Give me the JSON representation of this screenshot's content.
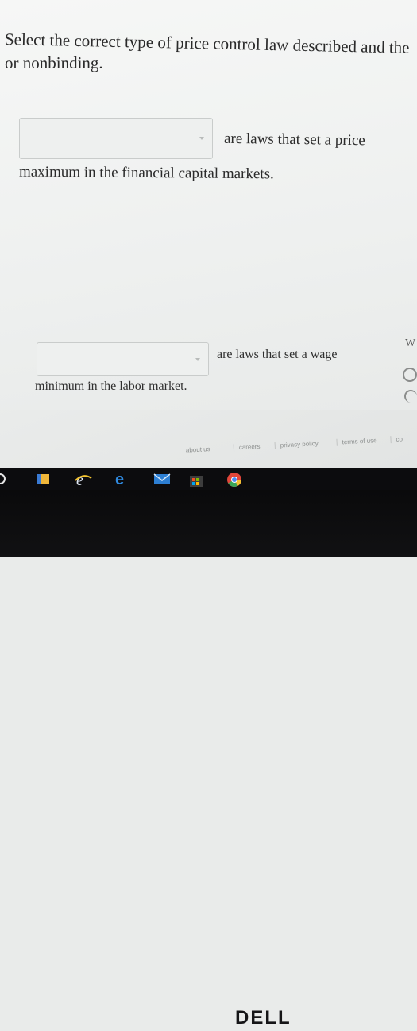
{
  "question": {
    "prompt_line1": "Select the correct type of price control law described and the",
    "prompt_line2": "or nonbinding."
  },
  "items": [
    {
      "select_value": "",
      "text_after": "are laws that set a price",
      "text_continued": "maximum in the financial capital markets."
    },
    {
      "select_value": "",
      "text_after": "are laws that set a wage",
      "text_continued": "minimum in the labor market."
    }
  ],
  "right_edge": {
    "letter": "W"
  },
  "footer": {
    "links": [
      "about us",
      "careers",
      "privacy policy",
      "terms of use",
      "co"
    ]
  },
  "taskbar": {
    "icons": [
      "back-circle-icon",
      "file-manager-icon",
      "internet-explorer-icon",
      "edge-icon",
      "mail-icon",
      "store-icon",
      "chrome-icon"
    ]
  },
  "monitor": {
    "brand": "DELL"
  }
}
